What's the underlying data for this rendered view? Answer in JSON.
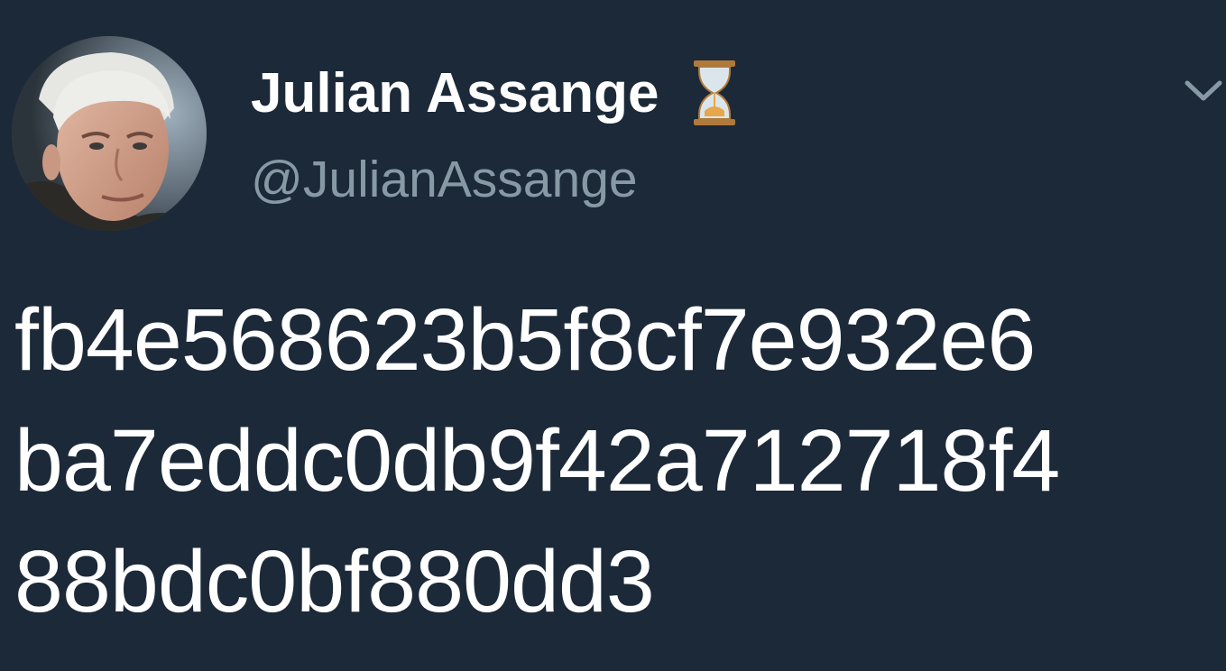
{
  "theme": {
    "background": "#1c2938",
    "text_primary": "#ffffff",
    "text_secondary": "#8899a6"
  },
  "author": {
    "display_name": "Julian Assange",
    "handle": "@JulianAssange",
    "name_emoji_icon": "hourglass-icon",
    "avatar_icon": "profile-photo"
  },
  "tweet": {
    "lines": [
      "fb4e568623b5f8cf7e932e6",
      "ba7eddc0db9f42a712718f4",
      "88bdc0bf880dd3"
    ]
  },
  "controls": {
    "menu_icon": "chevron-down-icon"
  }
}
